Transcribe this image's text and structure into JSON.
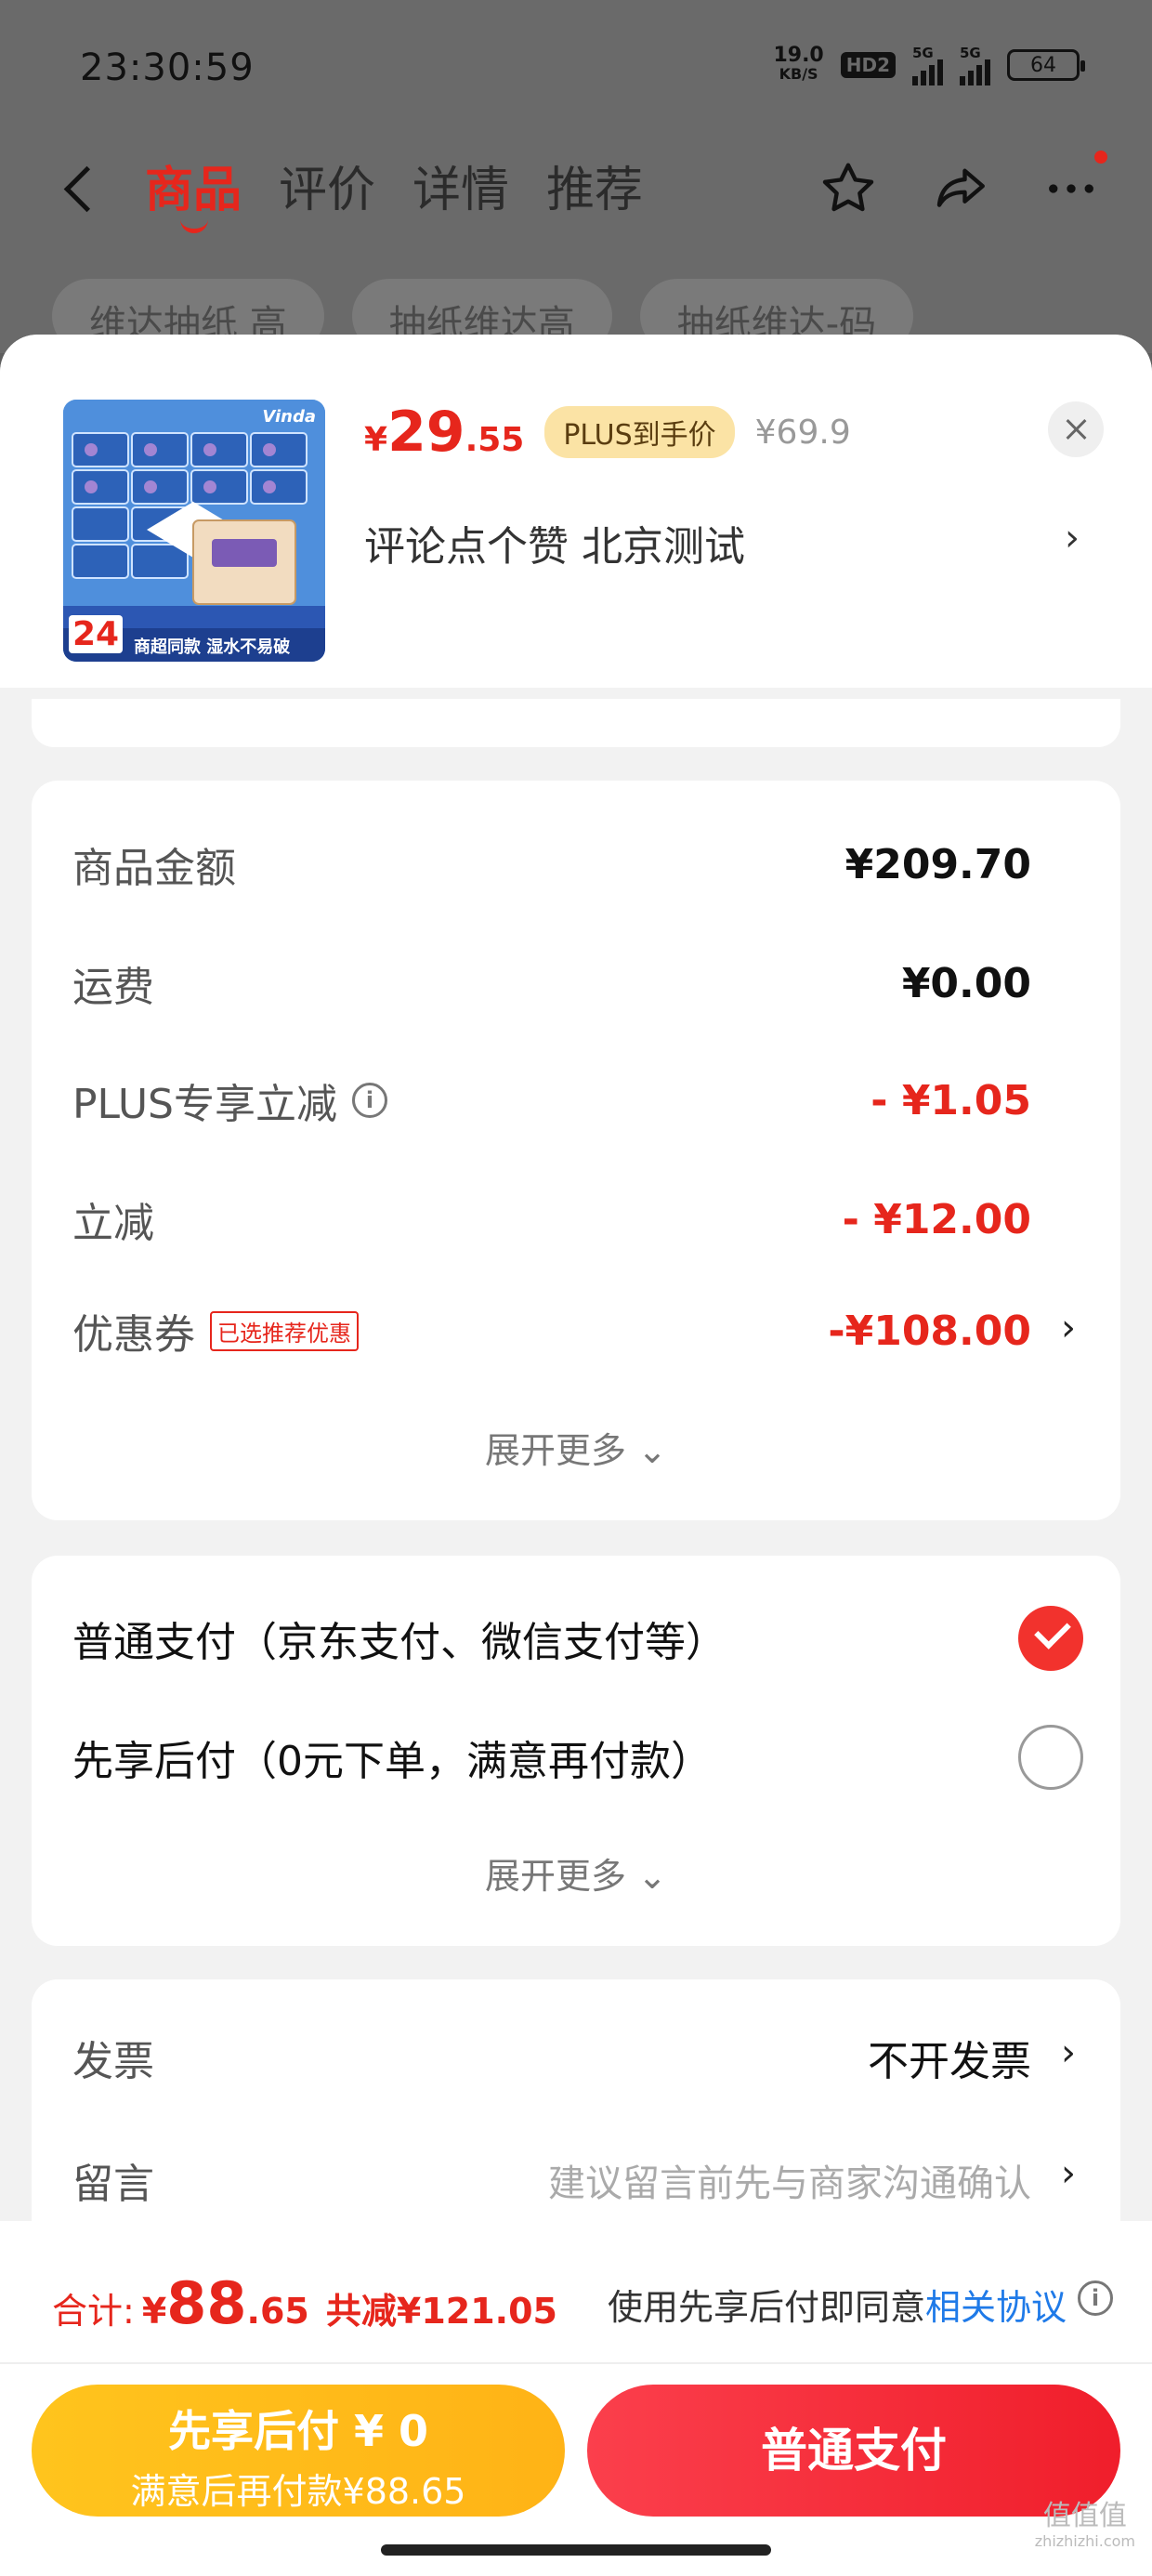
{
  "status_bar": {
    "time": "23:30:59",
    "net_speed": "19.0",
    "net_unit": "KB/S",
    "hd": "HD2",
    "sim1": "5G",
    "sim2": "5G",
    "battery": "64"
  },
  "nav": {
    "tabs": [
      {
        "label": "商品",
        "active": true
      },
      {
        "label": "评价"
      },
      {
        "label": "详情"
      },
      {
        "label": "推荐"
      }
    ],
    "icons": [
      "back-icon",
      "star-icon",
      "share-icon",
      "more-icon"
    ]
  },
  "chips": [
    "维达抽纸 高",
    "抽纸维达高",
    "抽纸维达-码"
  ],
  "product": {
    "price_currency": "¥",
    "price_int": "29",
    "price_dec": ".55",
    "plus_badge": "PLUS到手价",
    "original_price": "¥69.9",
    "spec": "评论点个赞  北京测试",
    "image_count_label": "24",
    "image_bottom_text": "商超同款 湿水不易破",
    "image_brand": "Vinda"
  },
  "amounts": {
    "goods_label": "商品金额",
    "goods_value": "¥209.70",
    "shipping_label": "运费",
    "shipping_value": "¥0.00",
    "plus_label": "PLUS专享立减",
    "plus_value": "- ¥1.05",
    "instant_label": "立减",
    "instant_value": "- ¥12.00",
    "coupon_label": "优惠券",
    "coupon_tag": "已选推荐优惠",
    "coupon_value": "-¥108.00",
    "expand_label": "展开更多"
  },
  "payment": {
    "option1": "普通支付（京东支付、微信支付等）",
    "option2": "先享后付（0元下单，满意再付款）",
    "expand_label": "展开更多"
  },
  "extras": {
    "invoice_label": "发票",
    "invoice_value": "不开发票",
    "memo_label": "留言",
    "memo_placeholder": "建议留言前先与商家沟通确认"
  },
  "footer": {
    "total_label": "合计:",
    "total_currency": "¥",
    "total_int": "88",
    "total_dec": ".65",
    "total_saved": "共减¥121.05",
    "agree_prefix": "使用先享后付即同意",
    "agree_link": "相关协议",
    "btn_later_line1": "先享后付 ¥ 0",
    "btn_later_line2": "满意后再付款¥88.65",
    "btn_normal": "普通支付",
    "watermark": "值值值",
    "watermark_sub": "zhizhizhi.com"
  },
  "colors": {
    "accent_red": "#e6261c",
    "link_blue": "#1f7ae8",
    "later_yellow": "#ffb316"
  }
}
